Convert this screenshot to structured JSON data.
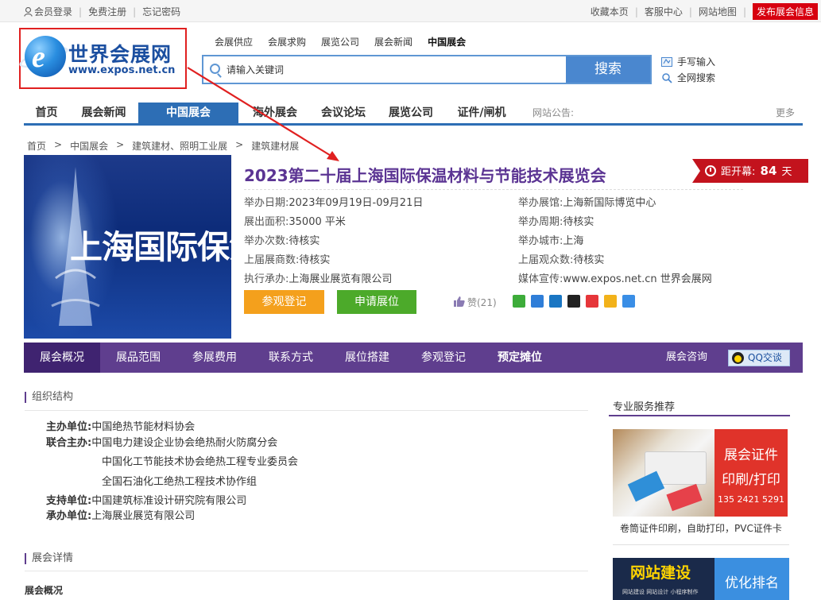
{
  "topbar": {
    "login": "会员登录",
    "register": "免费注册",
    "forgot": "忘记密码",
    "bookmark": "收藏本页",
    "service": "客服中心",
    "sitemap": "网站地图",
    "publish": "发布展会信息"
  },
  "logo": {
    "name": "世界会展网",
    "domain": "www.expos.net.cn"
  },
  "quick_nav": [
    "会展供应",
    "会展求购",
    "展览公司",
    "展会新闻",
    "中国展会"
  ],
  "search": {
    "placeholder": "请输入关键词",
    "button": "搜索",
    "handwrite": "手写输入",
    "fullsite": "全网搜索"
  },
  "main_nav": {
    "items": [
      "首页",
      "展会新闻",
      "中国展会",
      "海外展会",
      "会议论坛",
      "展览公司",
      "证件/闸机"
    ],
    "active": "中国展会",
    "notice_label": "网站公告:",
    "more": "更多"
  },
  "breadcrumb": [
    "首页",
    ">",
    "中国展会",
    ">",
    "建筑建材、照明工业展",
    ">",
    "建筑建材展"
  ],
  "poster": {
    "text": "上海国际保温展"
  },
  "expo": {
    "title": "2023第二十届上海国际保温材料与节能技术展览会",
    "countdown_label": "距开幕:",
    "countdown_days": "84",
    "countdown_unit": "天",
    "info_left": [
      {
        "k": "举办日期:",
        "v": "2023年09月19日-09月21日"
      },
      {
        "k": "展出面积:",
        "v": "35000 平米"
      },
      {
        "k": "举办次数:",
        "v": "待核实"
      },
      {
        "k": "上届展商数:",
        "v": "待核实"
      },
      {
        "k": "执行承办:",
        "v": "上海展业展览有限公司"
      }
    ],
    "info_right": [
      {
        "k": "举办展馆:",
        "v": "上海新国际博览中心"
      },
      {
        "k": "举办周期:",
        "v": "待核实"
      },
      {
        "k": "举办城市:",
        "v": "上海"
      },
      {
        "k": "上届观众数:",
        "v": "待核实"
      },
      {
        "k": "媒体宣传:",
        "v": "www.expos.net.cn 世界会展网"
      }
    ],
    "btn_visit": "参观登记",
    "btn_booth": "申请展位",
    "like": "赞(21)"
  },
  "tabs": {
    "items": [
      "展会概况",
      "展品范围",
      "参展费用",
      "联系方式",
      "展位搭建",
      "参观登记",
      "预定摊位"
    ],
    "active": "展会概况",
    "consult": "展会咨询",
    "qq": "QQ交谈"
  },
  "org": {
    "heading": "组织结构",
    "rows": [
      {
        "k": "主办单位:",
        "v": "中国绝热节能材料协会"
      },
      {
        "k": "联合主办:",
        "v": "中国电力建设企业协会绝热耐火防腐分会"
      },
      {
        "k": "",
        "v": "中国化工节能技术协会绝热工程专业委员会"
      },
      {
        "k": "",
        "v": "全国石油化工绝热工程技术协作组"
      },
      {
        "k": "支持单位:",
        "v": "中国建筑标准设计研究院有限公司"
      },
      {
        "k": "承办单位:",
        "v": "上海展业展览有限公司"
      }
    ]
  },
  "details": {
    "heading": "展会详情",
    "sub": "展会概况"
  },
  "sidebar": {
    "heading": "专业服务推荐",
    "ad1": {
      "line1": "展会证件",
      "line2": "印刷/打印",
      "phone": "135 2421 5291",
      "caption": "卷筒证件印刷，自助打印，PVC证件卡"
    },
    "ad2": {
      "left": "网站建设",
      "left_sub": "网站建设  网站设计  小程序制作",
      "right": "优化排名"
    }
  },
  "colors": {
    "brand_blue": "#2d6eb5",
    "purple": "#5f3e8e",
    "title_purple": "#5b3493",
    "red": "#c3131d",
    "orange": "#f4a01c",
    "green": "#4caa2a"
  }
}
